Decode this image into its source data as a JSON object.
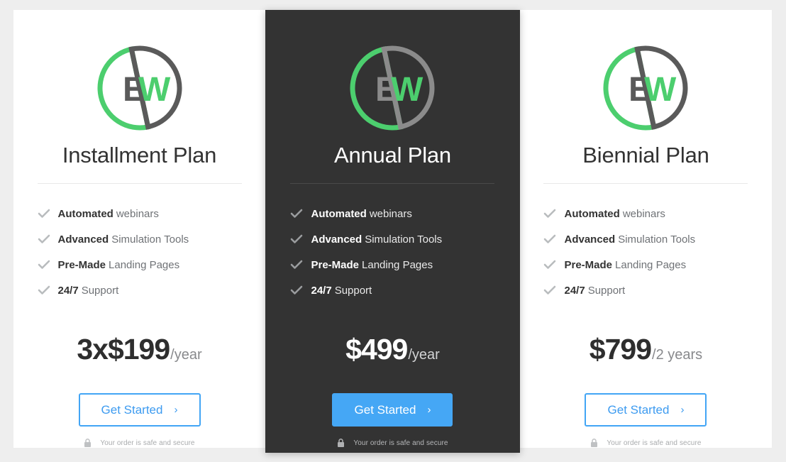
{
  "colors": {
    "page_background": "#eeeeee",
    "card_background": "#ffffff",
    "featured_card_background": "#333333",
    "accent_blue": "#42a5f5",
    "logo_green": "#4cce6e",
    "logo_gray": "#5a5a5a",
    "check_gray": "#b9bcbe",
    "title_text": "#333333"
  },
  "icons": {
    "check": "check-icon",
    "lock": "lock-icon",
    "chevron": "chevron-right-icon",
    "logo": "ew-circle-logo"
  },
  "common": {
    "cta_label": "Get Started",
    "cta_chevron": "›",
    "secure_text": "Your order is safe and secure",
    "logo_letters": "EW"
  },
  "plans": [
    {
      "id": "installment",
      "title": "Installment Plan",
      "featured": false,
      "features": [
        {
          "strong": "Automated",
          "rest": "webinars"
        },
        {
          "strong": "Advanced",
          "rest": "Simulation Tools"
        },
        {
          "strong": "Pre-Made",
          "rest": "Landing Pages"
        },
        {
          "strong": "24/7",
          "rest": "Support"
        }
      ],
      "price_main": "3x$199",
      "price_period": "/year",
      "cta_label": "Get Started",
      "secure_text": "Your order is safe and secure"
    },
    {
      "id": "annual",
      "title": "Annual Plan",
      "featured": true,
      "features": [
        {
          "strong": "Automated",
          "rest": "webinars"
        },
        {
          "strong": "Advanced",
          "rest": "Simulation Tools"
        },
        {
          "strong": "Pre-Made",
          "rest": "Landing Pages"
        },
        {
          "strong": "24/7",
          "rest": "Support"
        }
      ],
      "price_main": "$499",
      "price_period": "/year",
      "cta_label": "Get Started",
      "secure_text": "Your order is safe and secure"
    },
    {
      "id": "biennial",
      "title": "Biennial Plan",
      "featured": false,
      "features": [
        {
          "strong": "Automated",
          "rest": "webinars"
        },
        {
          "strong": "Advanced",
          "rest": "Simulation Tools"
        },
        {
          "strong": "Pre-Made",
          "rest": "Landing Pages"
        },
        {
          "strong": "24/7",
          "rest": "Support"
        }
      ],
      "price_main": "$799",
      "price_period": "/2 years",
      "cta_label": "Get Started",
      "secure_text": "Your order is safe and secure"
    }
  ]
}
